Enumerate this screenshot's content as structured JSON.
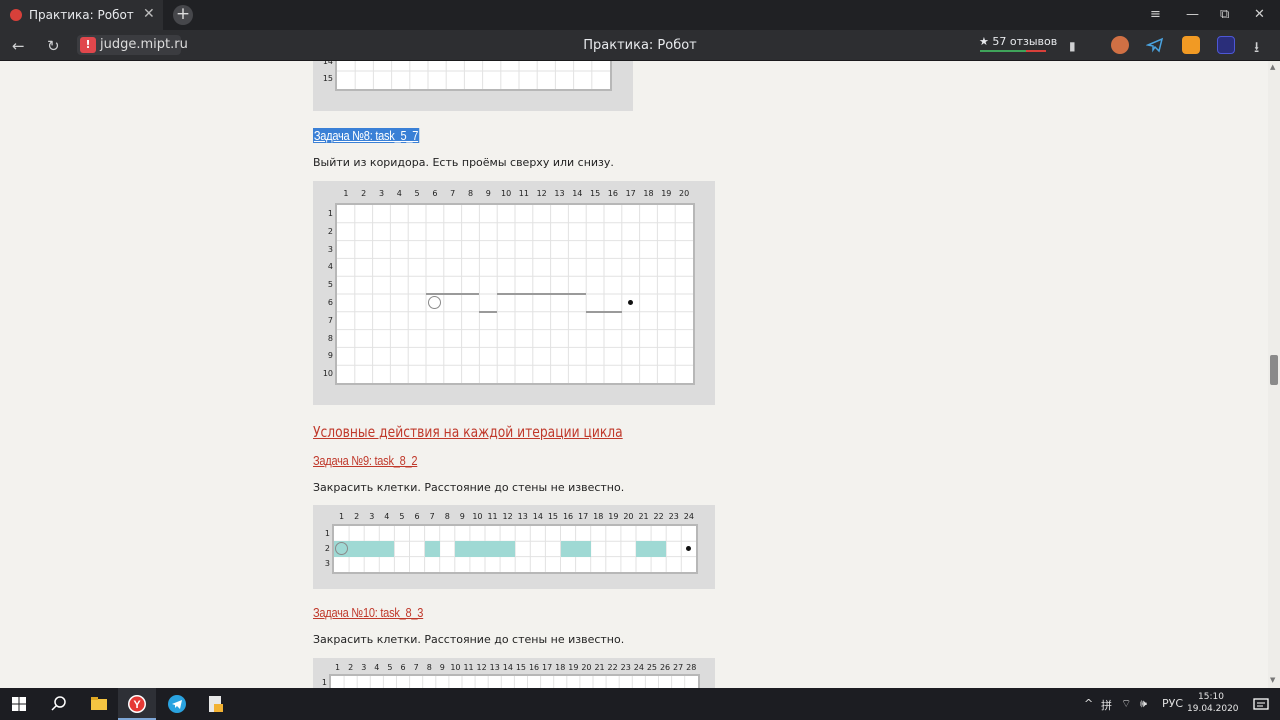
{
  "browser": {
    "tab_title": "Практика: Робот",
    "tab_close": "✕",
    "new_tab": "+",
    "window_controls": [
      "≡",
      "—",
      "⧉",
      "✕"
    ],
    "domain": "judge.mipt.ru",
    "warning_icon": "!",
    "page_title": "Практика: Робот",
    "reviews": "★ 57 отзывов",
    "back_icon": "←",
    "reload_icon": "↻",
    "download_icon": "⭳",
    "bookmark_icon": "▮"
  },
  "content": {
    "prev_grid": {
      "rows": [
        "14",
        "15"
      ]
    },
    "task8": {
      "heading": "Задача №8: task_5_7",
      "description": "Выйти из коридора. Есть проёмы сверху или снизу.",
      "columns": [
        "1",
        "2",
        "3",
        "4",
        "5",
        "6",
        "7",
        "8",
        "9",
        "10",
        "11",
        "12",
        "13",
        "14",
        "15",
        "16",
        "17",
        "18",
        "19",
        "20"
      ],
      "rows": [
        "1",
        "2",
        "3",
        "4",
        "5",
        "6",
        "7",
        "8",
        "9",
        "10"
      ],
      "robot": {
        "row": 6,
        "col": 6
      },
      "target": {
        "row": 6,
        "col": 17
      },
      "walls_top_of_row6": [
        [
          6,
          8
        ],
        [
          10,
          14
        ]
      ],
      "walls_bottom_of_row6": [
        [
          9,
          9
        ],
        [
          15,
          16
        ]
      ]
    },
    "section_heading": "Условные действия на каждой итерации цикла",
    "task9": {
      "heading": "Задача №9: task_8_2",
      "description": "Закрасить клетки. Расстояние до стены не известно.",
      "columns": [
        "1",
        "2",
        "3",
        "4",
        "5",
        "6",
        "7",
        "8",
        "9",
        "10",
        "11",
        "12",
        "13",
        "14",
        "15",
        "16",
        "17",
        "18",
        "19",
        "20",
        "21",
        "22",
        "23",
        "24"
      ],
      "rows": [
        "1",
        "2",
        "3"
      ],
      "robot": {
        "row": 2,
        "col": 1
      },
      "target": {
        "row": 2,
        "col": 24
      },
      "filled_cols_row2": [
        1,
        2,
        3,
        4,
        7,
        9,
        10,
        11,
        12,
        16,
        17,
        21,
        22
      ]
    },
    "task10": {
      "heading": "Задача №10: task_8_3",
      "description": "Закрасить клетки. Расстояние до стены не известно.",
      "columns": [
        "1",
        "2",
        "3",
        "4",
        "5",
        "6",
        "7",
        "8",
        "9",
        "10",
        "11",
        "12",
        "13",
        "14",
        "15",
        "16",
        "17",
        "18",
        "19",
        "20",
        "21",
        "22",
        "23",
        "24",
        "25",
        "26",
        "27",
        "28"
      ],
      "rows": [
        "1"
      ]
    }
  },
  "taskbar": {
    "lang": "РУС",
    "time": "15:10",
    "date": "19.04.2020",
    "tray_icons": [
      "^",
      "拼",
      "⌔",
      "🕪"
    ]
  },
  "colors": {
    "accent_link": "#c0392b",
    "selection": "#3a80d6",
    "fill": "#9fd9d4",
    "panel": "#dcdcdc"
  }
}
